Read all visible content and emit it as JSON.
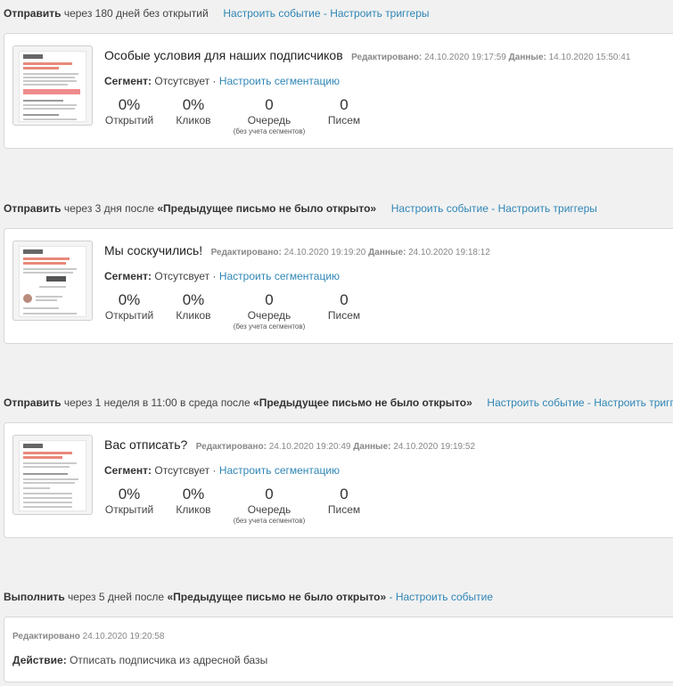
{
  "rules": [
    {
      "action": "Отправить",
      "condition": "через 180 дней без открытий",
      "trigger": "",
      "link_event": "Настроить событие",
      "link_sep": " - ",
      "link_triggers": "Настроить триггеры"
    },
    {
      "action": "Отправить",
      "condition": "через 3 дня после",
      "trigger": "«Предыдущее письмо не было открыто»",
      "link_event": "Настроить событие",
      "link_sep": " - ",
      "link_triggers": "Настроить триггеры"
    },
    {
      "action": "Отправить",
      "condition": "через 1 неделя в 11:00 в среда после",
      "trigger": "«Предыдущее письмо не было открыто»",
      "link_event": "Настроить событие",
      "link_sep": " - ",
      "link_triggers": "Настроить триггеры"
    },
    {
      "action": "Выполнить",
      "condition": "через 5 дней после",
      "trigger": "«Предыдущее письмо не было открыто»",
      "link_event": "Настроить событие",
      "link_sep": " - "
    }
  ],
  "emails": [
    {
      "title": "Особые условия для наших подписчиков",
      "edited_label": "Редактировано:",
      "edited": "24.10.2020 19:17:59",
      "data_label": "Данные:",
      "data": "14.10.2020 15:50:41",
      "segment_label": "Сегмент:",
      "segment_value": "Отсутсвует ·",
      "segment_link": "Настроить сегментацию",
      "stats": [
        {
          "value": "0%",
          "label": "Открытий"
        },
        {
          "value": "0%",
          "label": "Кликов"
        },
        {
          "value": "0",
          "label": "Очередь",
          "sub": "(без учета сегментов)"
        },
        {
          "value": "0",
          "label": "Писем"
        }
      ]
    },
    {
      "title": "Мы соскучились!",
      "edited_label": "Редактировано:",
      "edited": "24.10.2020 19:19:20",
      "data_label": "Данные:",
      "data": "24.10.2020 19:18:12",
      "segment_label": "Сегмент:",
      "segment_value": "Отсутсвует ·",
      "segment_link": "Настроить сегментацию",
      "stats": [
        {
          "value": "0%",
          "label": "Открытий"
        },
        {
          "value": "0%",
          "label": "Кликов"
        },
        {
          "value": "0",
          "label": "Очередь",
          "sub": "(без учета сегментов)"
        },
        {
          "value": "0",
          "label": "Писем"
        }
      ]
    },
    {
      "title": "Вас отписать?",
      "edited_label": "Редактировано:",
      "edited": "24.10.2020 19:20:49",
      "data_label": "Данные:",
      "data": "24.10.2020 19:19:52",
      "segment_label": "Сегмент:",
      "segment_value": "Отсутсвует ·",
      "segment_link": "Настроить сегментацию",
      "stats": [
        {
          "value": "0%",
          "label": "Открытий"
        },
        {
          "value": "0%",
          "label": "Кликов"
        },
        {
          "value": "0",
          "label": "Очередь",
          "sub": "(без учета сегментов)"
        },
        {
          "value": "0",
          "label": "Писем"
        }
      ]
    }
  ],
  "action_card": {
    "edited_label": "Редактировано",
    "edited": "24.10.2020 19:20:58",
    "action_label": "Действие:",
    "action_value": "Отписать подписчика из адресной базы"
  }
}
